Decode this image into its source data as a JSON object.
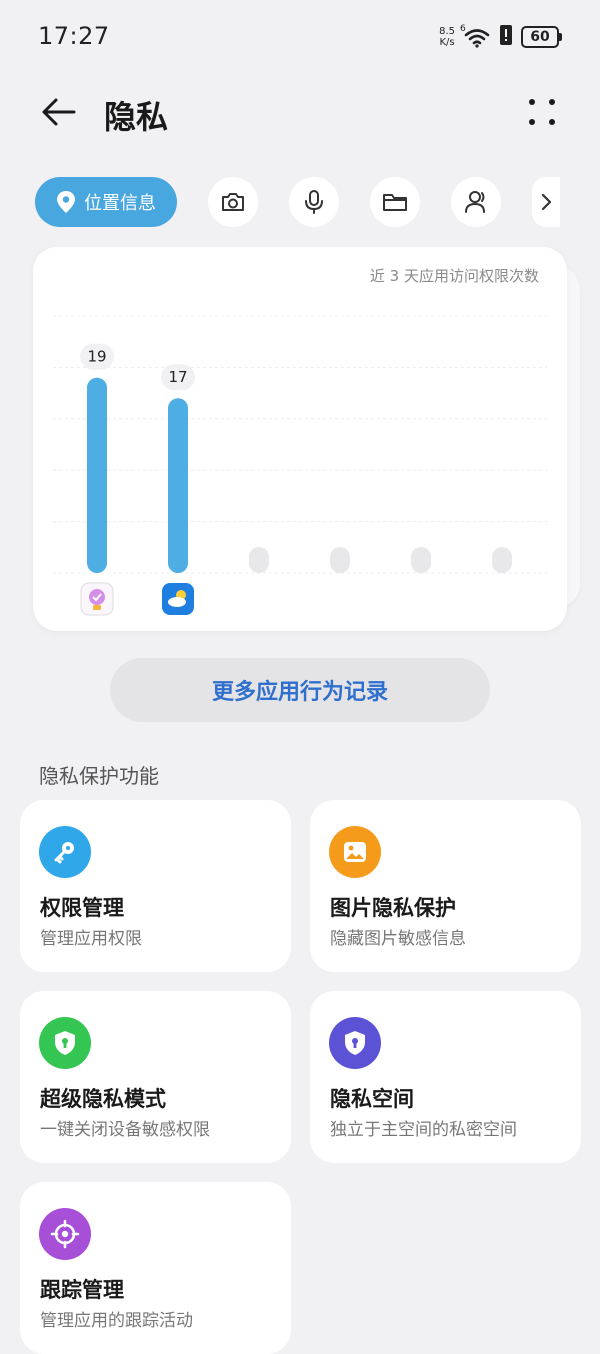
{
  "status_bar": {
    "time": "17:27",
    "net_speed_value": "8.5",
    "net_speed_unit": "K/s",
    "wifi_badge": "6",
    "battery": "60"
  },
  "header": {
    "title": "隐私",
    "back_icon": "arrow-left-icon",
    "more_icon": "four-dots-icon"
  },
  "chips": {
    "active_label": "位置信息",
    "active_icon": "location-pin-icon",
    "icons": [
      "camera-icon",
      "microphone-icon",
      "folder-icon",
      "contacts-icon",
      "chevron-right-icon"
    ]
  },
  "chart_data": {
    "type": "bar",
    "caption": "近 3 天应用访问权限次数",
    "values": [
      19,
      17,
      0,
      0,
      0,
      0
    ],
    "data_labels": [
      "19",
      "17"
    ],
    "app_icons": [
      "theme-app-icon",
      "weather-app-icon"
    ],
    "ylim": [
      0,
      25
    ],
    "grid": true,
    "bar_color": "#4eaee3",
    "empty_color": "#e8e8ea"
  },
  "more_records_label": "更多应用行为记录",
  "section_title": "隐私保护功能",
  "features": [
    {
      "title": "权限管理",
      "subtitle": "管理应用权限",
      "icon": "key-icon",
      "color": "#2fa7e8"
    },
    {
      "title": "图片隐私保护",
      "subtitle": "隐藏图片敏感信息",
      "icon": "picture-icon",
      "color": "#f59b1b"
    },
    {
      "title": "超级隐私模式",
      "subtitle": "一键关闭设备敏感权限",
      "icon": "shield-lock-icon",
      "color": "#34c552"
    },
    {
      "title": "隐私空间",
      "subtitle": "独立于主空间的私密空间",
      "icon": "shield-lock-icon",
      "color": "#5b52d6"
    },
    {
      "title": "跟踪管理",
      "subtitle": "管理应用的跟踪活动",
      "icon": "target-icon",
      "color": "#a74fd6"
    }
  ]
}
